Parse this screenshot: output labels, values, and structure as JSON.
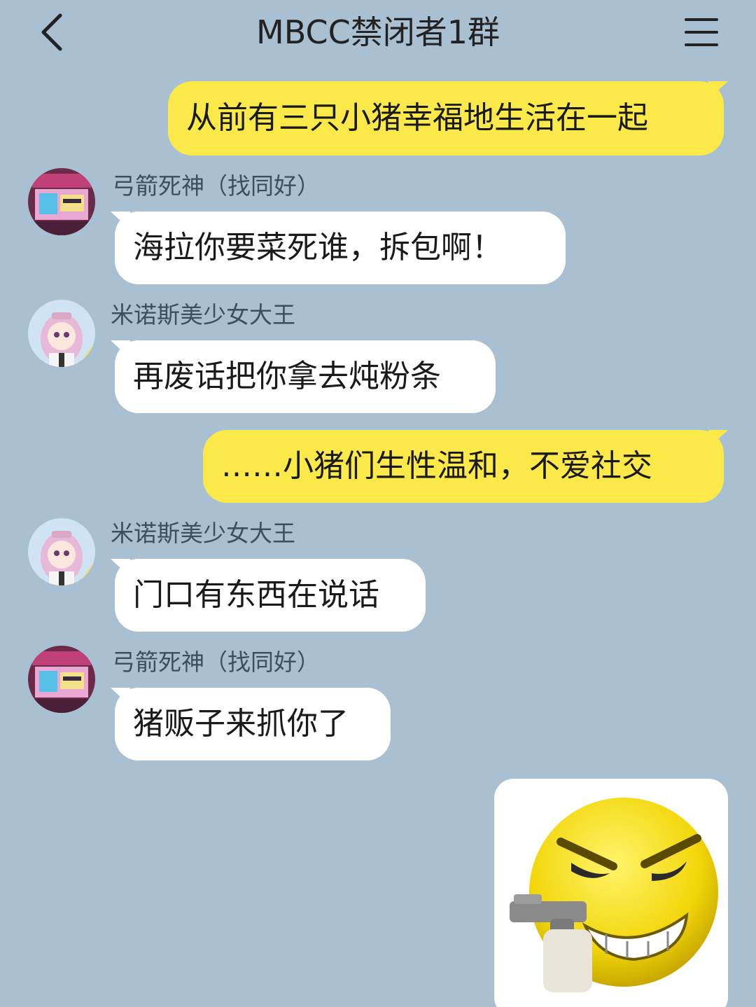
{
  "header": {
    "title": "MBCC禁闭者1群",
    "back_icon": "chevron-left-icon",
    "menu_icon": "hamburger-menu-icon"
  },
  "colors": {
    "background": "#a9c0d3",
    "my_bubble": "#fbe94a",
    "their_bubble": "#ffffff"
  },
  "messages": [
    {
      "from": "me",
      "text": "从前有三只小猪幸福地生活在一起"
    },
    {
      "from": "them",
      "sender": "弓箭死神（找同好）",
      "avatar": "game-screen-avatar",
      "text": "海拉你要菜死谁，拆包啊！"
    },
    {
      "from": "them",
      "sender": "米诺斯美少女大王",
      "avatar": "anime-girl-avatar",
      "text": "再废话把你拿去炖粉条"
    },
    {
      "from": "me",
      "text": "……小猪们生性温和，不爱社交"
    },
    {
      "from": "them",
      "sender": "米诺斯美少女大王",
      "avatar": "anime-girl-avatar",
      "text": "门口有东西在说话"
    },
    {
      "from": "them",
      "sender": "弓箭死神（找同好）",
      "avatar": "game-screen-avatar",
      "text": "猪贩子来抓你了"
    },
    {
      "from": "me",
      "type": "sticker",
      "sticker": "angry-emoji-with-gun-sticker"
    }
  ]
}
